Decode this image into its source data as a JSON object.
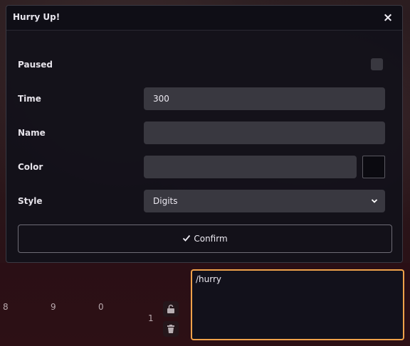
{
  "dialog": {
    "title": "Hurry Up!",
    "close_glyph": "×",
    "fields": {
      "paused_label": "Paused",
      "paused_checked": false,
      "time_label": "Time",
      "time_value": "300",
      "name_label": "Name",
      "name_value": "",
      "color_label": "Color",
      "color_value": "",
      "color_swatch": "#0b0a10",
      "style_label": "Style",
      "style_value": "Digits"
    },
    "confirm_label": "Confirm",
    "confirm_icon": "check-icon"
  },
  "background": {
    "numbers": [
      "8",
      "9",
      "0",
      "1"
    ],
    "icons": [
      "unlock-icon",
      "trash-icon"
    ]
  },
  "chat": {
    "value": "/hurry"
  },
  "colors": {
    "accent": "#f0a24a",
    "dialog_bg": "#12111a",
    "field_bg": "#393840"
  }
}
